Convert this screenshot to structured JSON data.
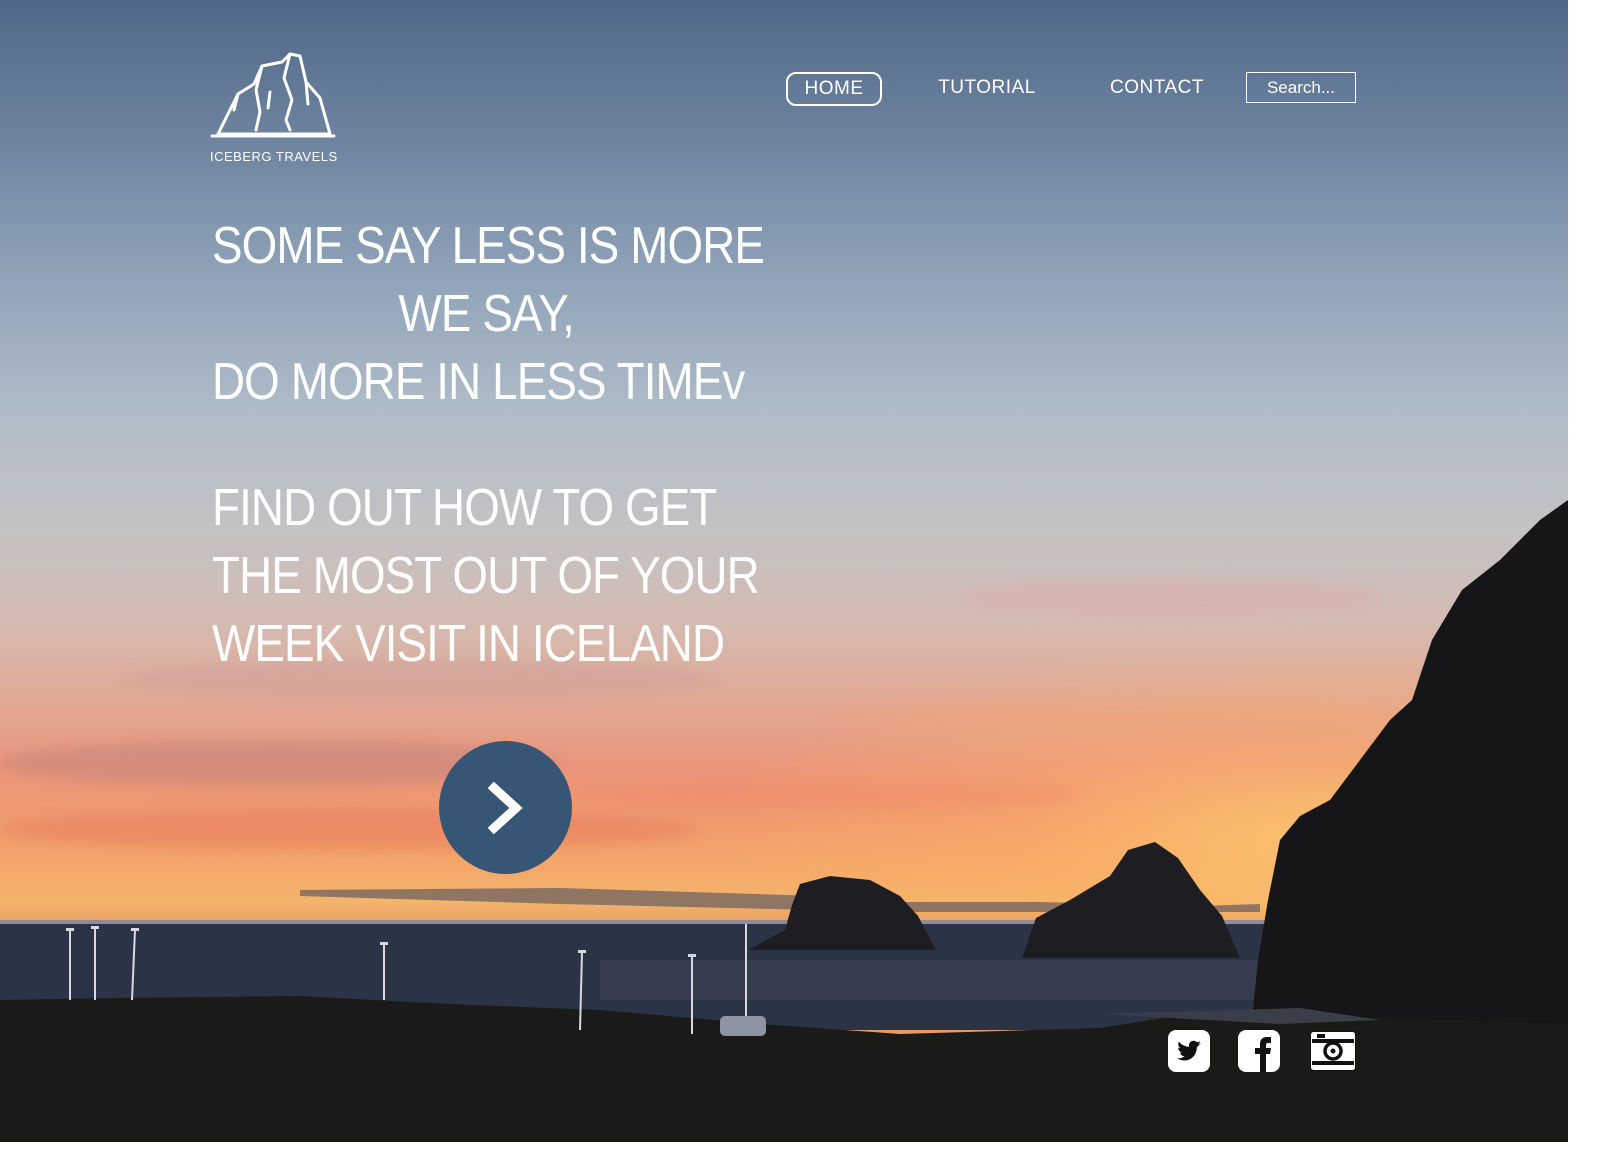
{
  "brand": {
    "name": "ICEBERG TRAVELS",
    "logo_icon": "iceberg-icon"
  },
  "nav": {
    "items": [
      {
        "label": "HOME",
        "active": true
      },
      {
        "label": "TUTORIAL",
        "active": false
      },
      {
        "label": "CONTACT",
        "active": false
      }
    ]
  },
  "search": {
    "placeholder": "Search..."
  },
  "hero": {
    "headline": [
      "SOME SAY LESS IS MORE",
      "WE SAY,",
      "DO MORE IN LESS TIMEv"
    ],
    "subheadline": [
      "FIND OUT HOW TO GET",
      "THE MOST OUT OF YOUR",
      "WEEK VISIT IN ICELAND"
    ],
    "cta_icon": "chevron-right-icon"
  },
  "social": [
    {
      "name": "twitter",
      "icon": "twitter-icon"
    },
    {
      "name": "facebook",
      "icon": "facebook-icon"
    },
    {
      "name": "camera",
      "icon": "camera-icon"
    }
  ],
  "colors": {
    "accent": "#375574",
    "text": "#ffffff",
    "sky_top": "#4f6789",
    "sunset": "#f4a86a"
  }
}
